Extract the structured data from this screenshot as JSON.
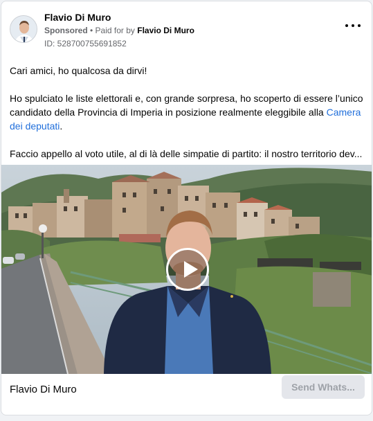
{
  "ad": {
    "page_name": "Flavio Di Muro",
    "sponsored_label": "Sponsored",
    "separator": " • ",
    "paid_for_prefix": "Paid for by ",
    "paid_for_by": "Flavio Di Muro",
    "ad_id": "ID: 528700755691852",
    "more_icon": "more-options-icon"
  },
  "body": {
    "p1": "Cari amici, ho qualcosa da dirvi!",
    "p2_text": "Ho spulciato le liste elettorali e, con grande sorpresa, ho scoperto di essere l’unico candidato della Provincia di Imperia in posizione realmente eleggibile alla ",
    "p2_link": "Camera dei deputati",
    "p2_end": ".",
    "p3": "Faccio appello al voto utile, al di là delle simpatie di partito: il nostro territorio dev..."
  },
  "video": {
    "play_icon": "play-icon"
  },
  "footer": {
    "title": "Flavio Di Muro",
    "cta_label": "Send Whats..."
  },
  "colors": {
    "link": "#216fdb",
    "muted_text": "#65676b",
    "cta_bg": "#e4e6eb",
    "cta_text": "#9ea2a8"
  }
}
